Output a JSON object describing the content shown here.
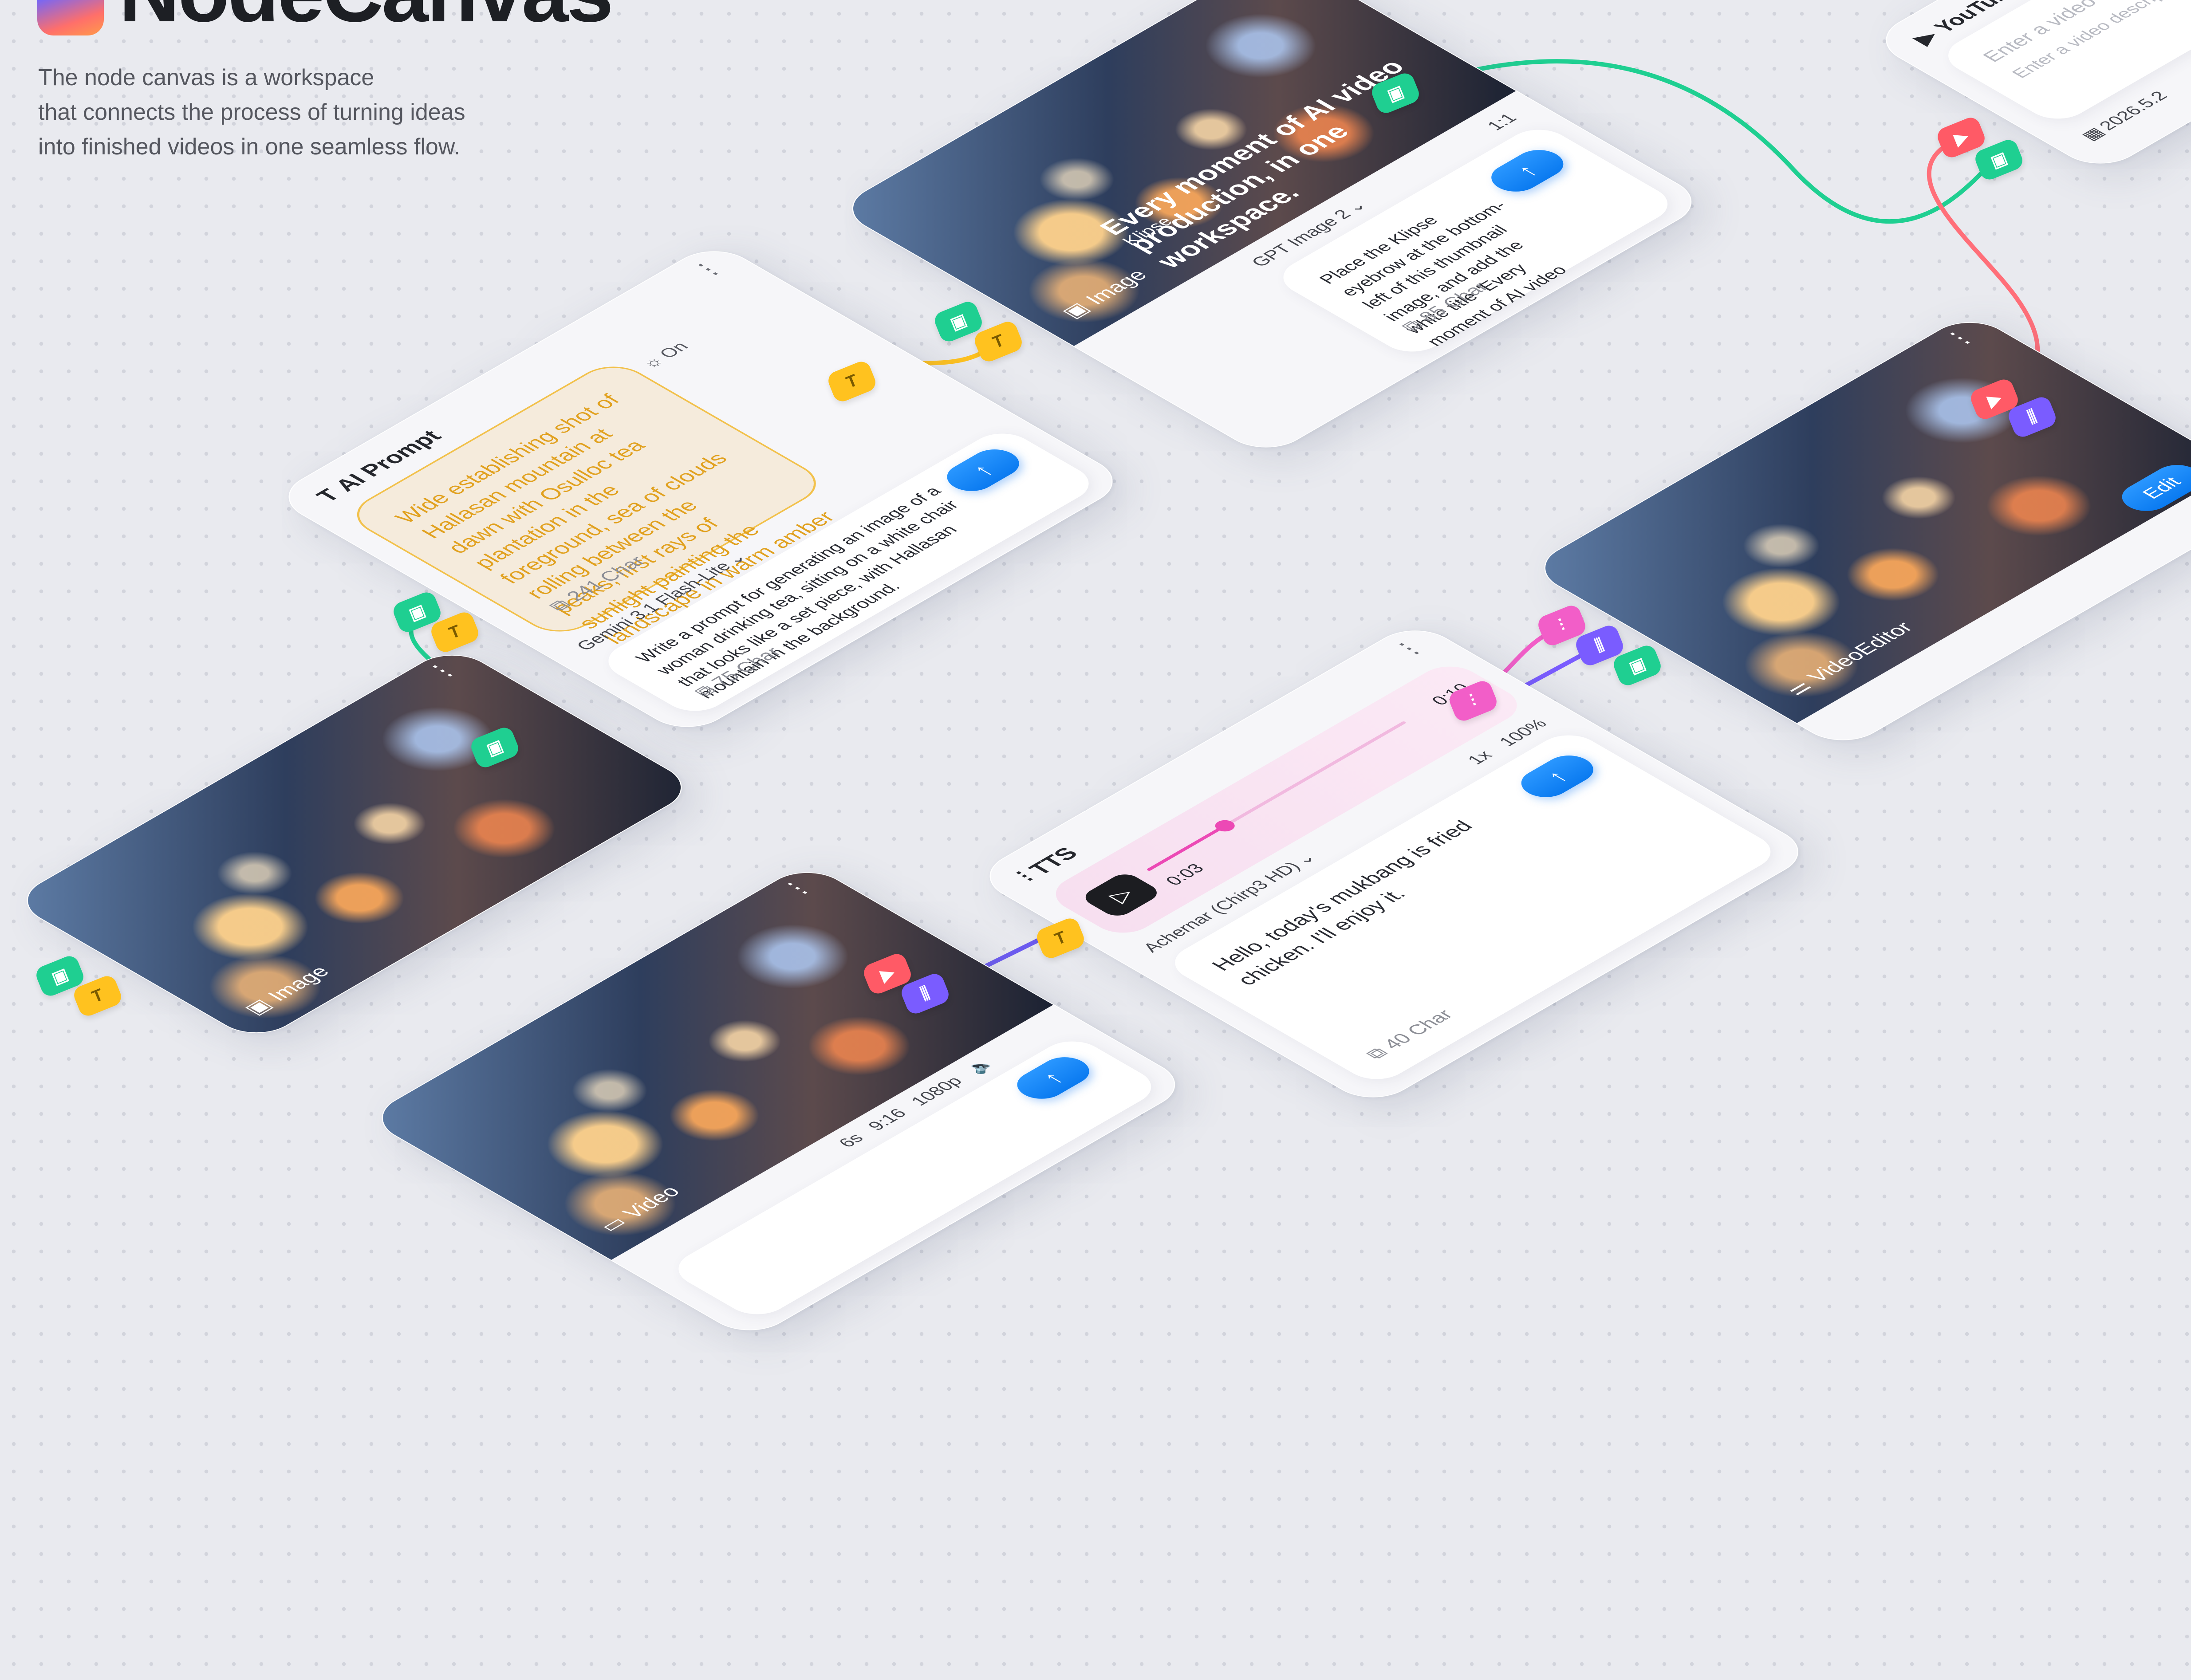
{
  "header": {
    "app_title": "NodeCanvas",
    "description_lines": [
      "The node canvas is a workspace",
      "that connects the process of turning ideas",
      "into finished videos in one seamless flow."
    ]
  },
  "nodes": {
    "image_top": {
      "label": "Image",
      "overlay_eyebrow": "Klipse",
      "overlay_title": "Every moment of AI video production, in one workspace.",
      "ratio": "1:1",
      "model": "GPT Image 2",
      "prompt": "Place the Klipse eyebrow at the bottom-left of this thumbnail image, and add the white title \"Every moment of AI video production, in one workspace.\" b...",
      "char_count": "85 Char",
      "send_icon": "arrow-up-icon"
    },
    "ai_prompt": {
      "label": "AI Prompt",
      "generated_text": "Wide establishing shot of Hallasan mountain at dawn with Osulloc tea plantation in the foreground, sea of clouds rolling between the peaks, first rays of sunlight painting the landscape in warm amber and cool blue tones, epic cinematic scale",
      "generated_count": "241 Char",
      "toggle_label": "On",
      "model": "Gemini 3.1 Flash-Lite",
      "prompt": "Write a prompt for generating an image of a woman drinking tea, sitting on a white chair that looks like a set piece, with Hallasan mountain in the background.",
      "char_count": "75 Char"
    },
    "image_left": {
      "label": "Image"
    },
    "video": {
      "label": "Video",
      "duration": "6s",
      "ratio": "9:16",
      "resolution": "1080p"
    },
    "tts": {
      "label": "TTS",
      "time_current": "0:03",
      "time_total": "0:10",
      "speed": "1x",
      "volume": "100%",
      "voice": "Achernar (Chirp3 HD)",
      "prompt": "Hello, today's mukbang is fried chicken. I'll enjoy it.",
      "char_count": "40 Char",
      "progress": 0.3
    },
    "video_editor": {
      "label": "VideoEditor",
      "edit_button": "Edit"
    },
    "youtube": {
      "label": "YouTube",
      "title_placeholder": "Enter a video title.",
      "desc_placeholder": "Enter a video description.",
      "date": "2026.5.2"
    }
  },
  "colors": {
    "accent_blue": "#0a7af0",
    "port_green": "#1fcf91",
    "port_yellow": "#ffc21f",
    "port_red": "#ff5a66",
    "port_purple": "#7a5cff",
    "port_pink": "#f25ec8"
  }
}
